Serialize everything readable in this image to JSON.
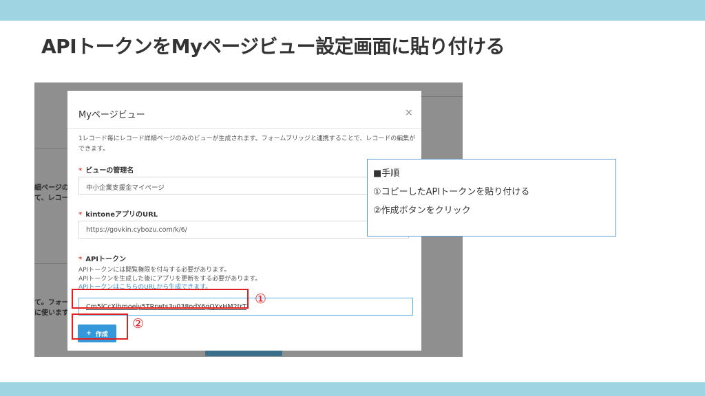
{
  "slide": {
    "title": "APIトークンをMyページビュー設定画面に貼り付ける"
  },
  "background": {
    "fragments": [
      "細ページの",
      "て、レコード",
      "て。フォーム",
      "に使います"
    ]
  },
  "modal": {
    "title": "Myページビュー",
    "close_icon": "×",
    "description": "1レコード毎にレコード詳細ページのみのビューが生成されます。フォームブリッジと連携することで、レコードの編集ができます。",
    "fields": [
      {
        "label": "ビューの管理名",
        "value": "中小企業支援金マイページ"
      },
      {
        "label": "kintoneアプリのURL",
        "value": "https://govkin.cybozu.com/k/6/"
      }
    ],
    "api_token": {
      "label": "APIトークン",
      "help": [
        "APIトークンには閲覧権限を付与する必要があります。",
        "APIトークンを生成した後にアプリを更新をする必要があります。"
      ],
      "help_link": "APIトークンはこちらのURLから生成できます。",
      "value": "Cm5lCcXlhmoeiy5TRrwts3v038ndY6gQYxHM2trT"
    },
    "create_button": {
      "icon": "+",
      "label": "作成"
    },
    "required_mark": "*"
  },
  "annotations": {
    "marker1": "①",
    "marker2": "②",
    "color": "#e02020"
  },
  "note": {
    "heading": "■手順",
    "steps": [
      "①コピーしたAPIトークンを貼り付ける",
      "②作成ボタンをクリック"
    ]
  },
  "colors": {
    "band": "#9fd5e3",
    "accent": "#3498db",
    "note_border": "#5b9bd5"
  }
}
